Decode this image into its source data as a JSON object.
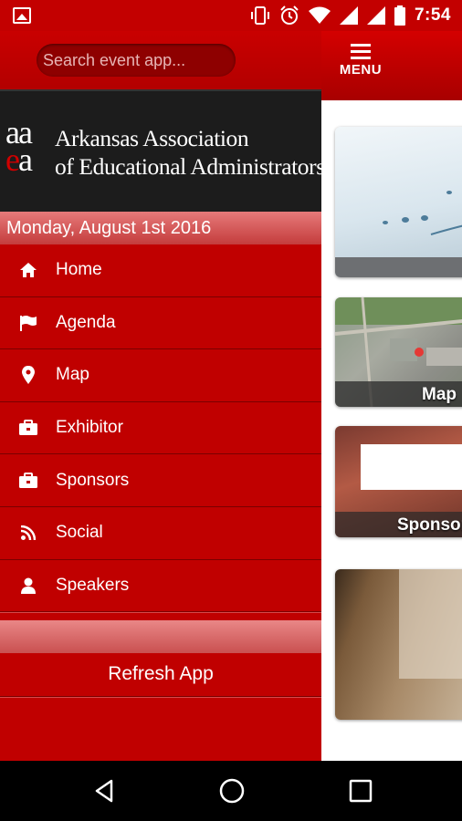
{
  "status_bar": {
    "time": "7:54",
    "icons": [
      "image-icon",
      "vibrate-icon",
      "alarm-icon",
      "wifi-icon",
      "signal-icon",
      "signal-icon",
      "battery-icon"
    ]
  },
  "header": {
    "menu_label": "MENU",
    "menu_icon": "list-icon"
  },
  "tiles": [
    {
      "label": ""
    },
    {
      "label": "Map"
    },
    {
      "label": "Sponsors"
    },
    {
      "label": ""
    }
  ],
  "drawer": {
    "search": {
      "placeholder": "Search event app...",
      "value": ""
    },
    "logo": {
      "mark_top": "aa",
      "mark_bottom_e": "e",
      "mark_bottom_a": "a",
      "line1": "Arkansas Association",
      "line2": "of Educational Administrators"
    },
    "date": "Monday, August 1st 2016",
    "items": [
      {
        "label": "Home",
        "icon": "home-icon"
      },
      {
        "label": "Agenda",
        "icon": "flag-icon"
      },
      {
        "label": "Map",
        "icon": "map-marker-icon"
      },
      {
        "label": "Exhibitor",
        "icon": "briefcase-icon"
      },
      {
        "label": "Sponsors",
        "icon": "briefcase-icon"
      },
      {
        "label": "Social",
        "icon": "rss-icon"
      },
      {
        "label": "Speakers",
        "icon": "user-icon"
      }
    ],
    "refresh_label": "Refresh App"
  },
  "colors": {
    "brand_red": "#c00000",
    "dark_red": "#8e0000",
    "banner_black": "#1c1c1c"
  }
}
